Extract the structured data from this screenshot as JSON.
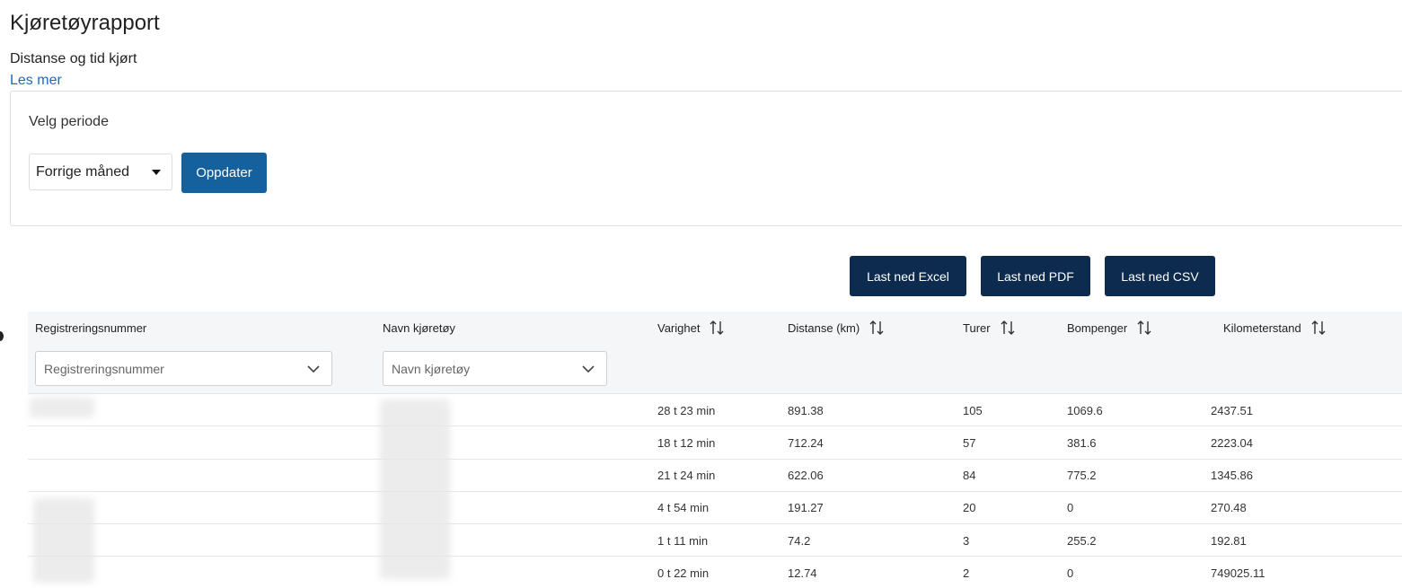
{
  "header": {
    "title": "Kjøretøyrapport",
    "subtitle": "Distanse og tid kjørt",
    "read_more": "Les mer"
  },
  "period": {
    "label": "Velg periode",
    "selected": "Forrige måned",
    "update_label": "Oppdater"
  },
  "downloads": {
    "excel": "Last ned Excel",
    "pdf": "Last ned PDF",
    "csv": "Last ned CSV"
  },
  "table": {
    "headers": {
      "reg": "Registreringsnummer",
      "name": "Navn kjøretøy",
      "duration": "Varighet",
      "distance": "Distanse (km)",
      "trips": "Turer",
      "tolls": "Bompenger",
      "odometer": "Kilometerstand"
    },
    "filters": {
      "reg_placeholder": "Registreringsnummer",
      "name_placeholder": "Navn kjøretøy"
    },
    "rows": [
      {
        "duration": "28 t 23 min",
        "distance": "891.38",
        "trips": "105",
        "tolls": "1069.6",
        "odometer": "2437.51"
      },
      {
        "duration": "18 t 12 min",
        "distance": "712.24",
        "trips": "57",
        "tolls": "381.6",
        "odometer": "2223.04"
      },
      {
        "duration": "21 t 24 min",
        "distance": "622.06",
        "trips": "84",
        "tolls": "775.2",
        "odometer": "1345.86"
      },
      {
        "duration": "4 t 54 min",
        "distance": "191.27",
        "trips": "20",
        "tolls": "0",
        "odometer": "270.48"
      },
      {
        "duration": "1 t 11 min",
        "distance": "74.2",
        "trips": "3",
        "tolls": "255.2",
        "odometer": "192.81"
      },
      {
        "duration": "0 t 22 min",
        "distance": "12.74",
        "trips": "2",
        "tolls": "0",
        "odometer": "749025.11"
      }
    ]
  },
  "icons": {
    "sort": "sort-arrows-icon",
    "select_caret": "caret-down-icon",
    "filter_chevron": "chevron-down-icon"
  }
}
